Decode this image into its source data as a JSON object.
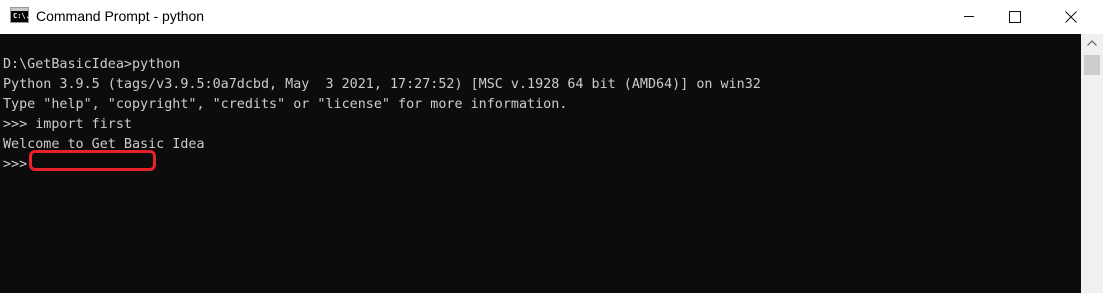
{
  "window": {
    "title": "Command Prompt - python",
    "icon": "cmd-app-icon",
    "icon_glyph": "C:\\."
  },
  "controls": {
    "minimize": "minimize-icon",
    "maximize": "maximize-icon",
    "close": "close-icon"
  },
  "console": {
    "lines": [
      "D:\\GetBasicIdea>python",
      "Python 3.9.5 (tags/v3.9.5:0a7dcbd, May  3 2021, 17:27:52) [MSC v.1928 64 bit (AMD64)] on win32",
      "Type \"help\", \"copyright\", \"credits\" or \"license\" for more information.",
      ">>> import first",
      "Welcome to Get Basic Idea",
      ">>>"
    ],
    "highlighted_command": "import first"
  },
  "colors": {
    "console_background": "#0c0c0c",
    "console_text": "#cccccc",
    "highlight_border": "#e8212b",
    "titlebar": "#ffffff"
  }
}
